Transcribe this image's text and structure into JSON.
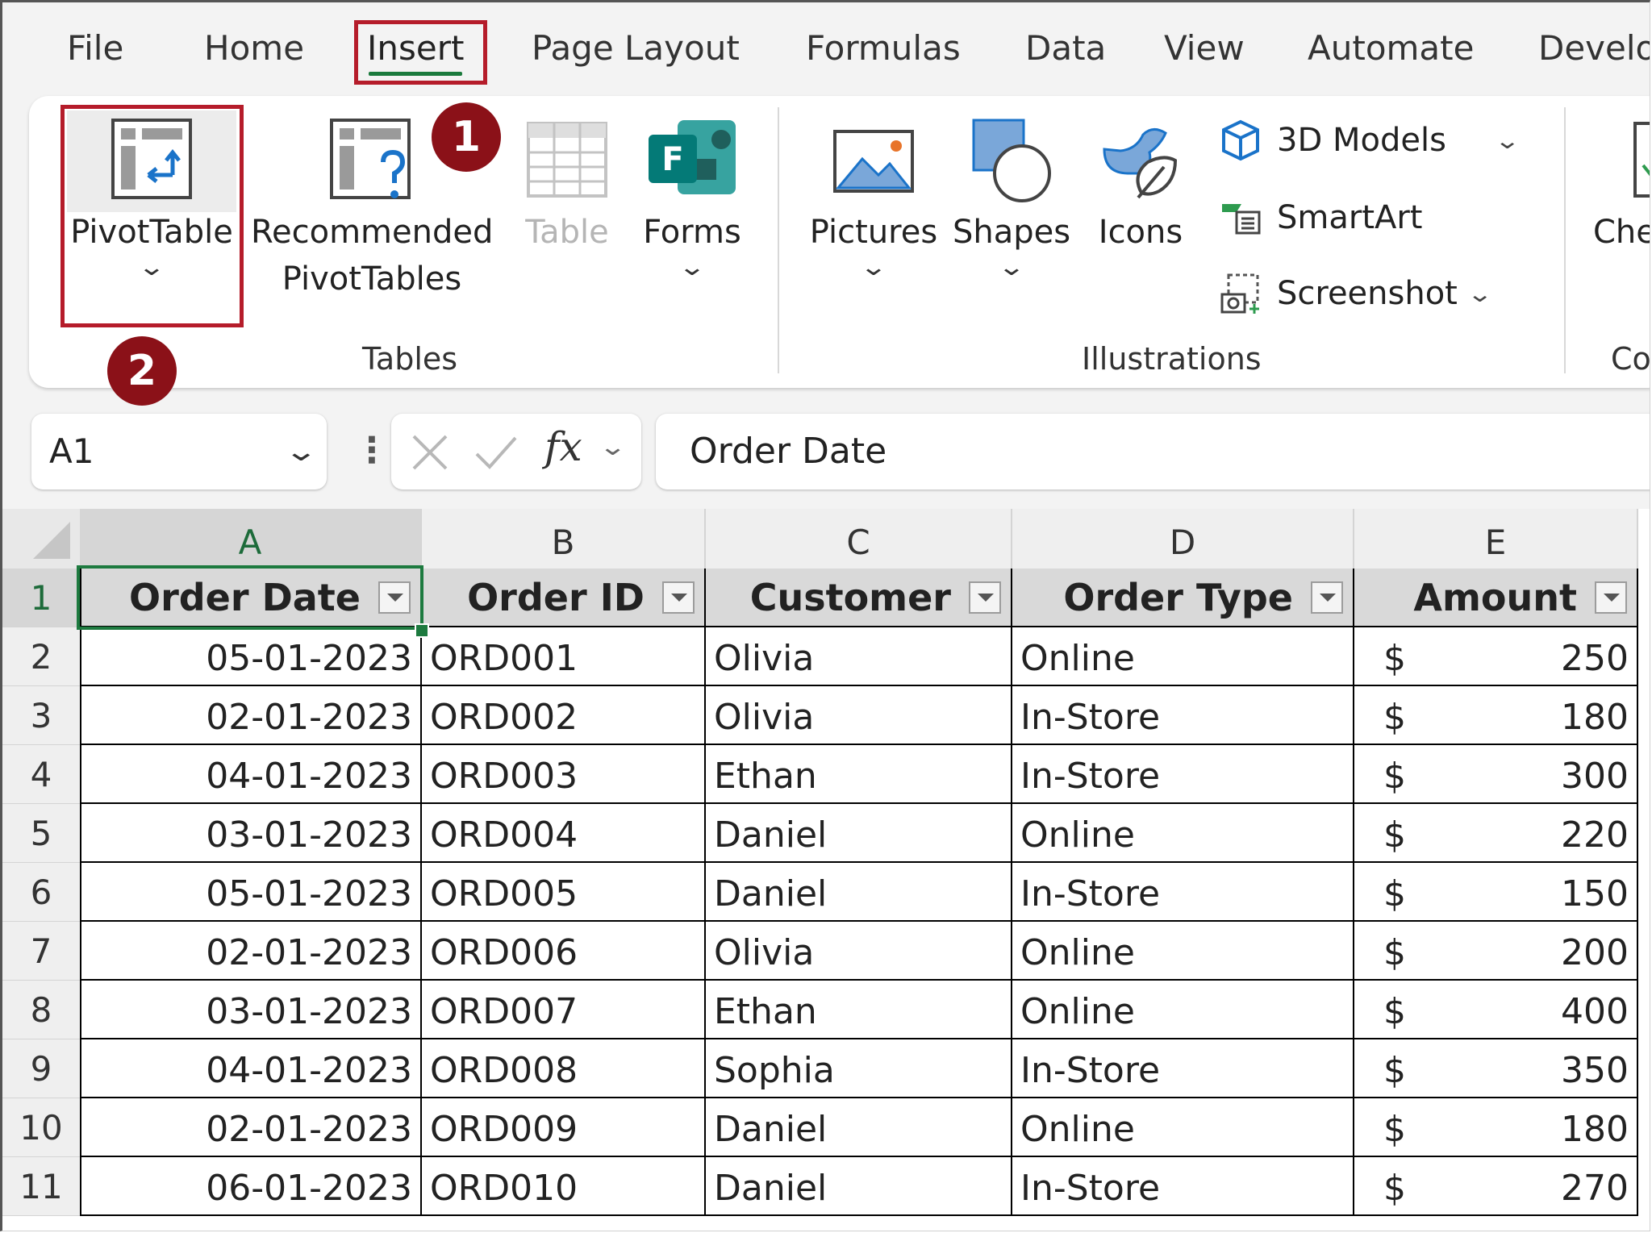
{
  "menu": {
    "tabs": [
      "File",
      "Home",
      "Insert",
      "Page Layout",
      "Formulas",
      "Data",
      "View",
      "Automate",
      "Develo"
    ],
    "active": "Insert"
  },
  "ribbon": {
    "pivottable": "PivotTable",
    "recommended_line1": "Recommended",
    "recommended_line2": "PivotTables",
    "table": "Table",
    "forms": "Forms",
    "pictures": "Pictures",
    "shapes": "Shapes",
    "icons": "Icons",
    "models3d": "3D Models",
    "smartart": "SmartArt",
    "screenshot": "Screenshot",
    "group_tables": "Tables",
    "group_illustrations": "Illustrations",
    "cut_check": "Che",
    "cut_group": "Co"
  },
  "badges": {
    "one": "1",
    "two": "2"
  },
  "formula_bar": {
    "name_box": "A1",
    "fx": "fx",
    "value": "Order Date"
  },
  "grid": {
    "columns": [
      "A",
      "B",
      "C",
      "D",
      "E"
    ],
    "rows": [
      "1",
      "2",
      "3",
      "4",
      "5",
      "6",
      "7",
      "8",
      "9",
      "10",
      "11"
    ],
    "headers": [
      "Order Date",
      "Order ID",
      "Customer",
      "Order Type",
      "Amount"
    ],
    "currency": "$",
    "data": [
      [
        "05-01-2023",
        "ORD001",
        "Olivia",
        "Online",
        "250"
      ],
      [
        "02-01-2023",
        "ORD002",
        "Olivia",
        "In-Store",
        "180"
      ],
      [
        "04-01-2023",
        "ORD003",
        "Ethan",
        "In-Store",
        "300"
      ],
      [
        "03-01-2023",
        "ORD004",
        "Daniel",
        "Online",
        "220"
      ],
      [
        "05-01-2023",
        "ORD005",
        "Daniel",
        "In-Store",
        "150"
      ],
      [
        "02-01-2023",
        "ORD006",
        "Olivia",
        "Online",
        "200"
      ],
      [
        "03-01-2023",
        "ORD007",
        "Ethan",
        "Online",
        "400"
      ],
      [
        "04-01-2023",
        "ORD008",
        "Sophia",
        "In-Store",
        "350"
      ],
      [
        "02-01-2023",
        "ORD009",
        "Daniel",
        "Online",
        "180"
      ],
      [
        "06-01-2023",
        "ORD010",
        "Daniel",
        "In-Store",
        "270"
      ]
    ]
  },
  "colors": {
    "accent_green": "#1d7a3f",
    "highlight_red": "#b51c2a",
    "badge": "#8b1118"
  }
}
